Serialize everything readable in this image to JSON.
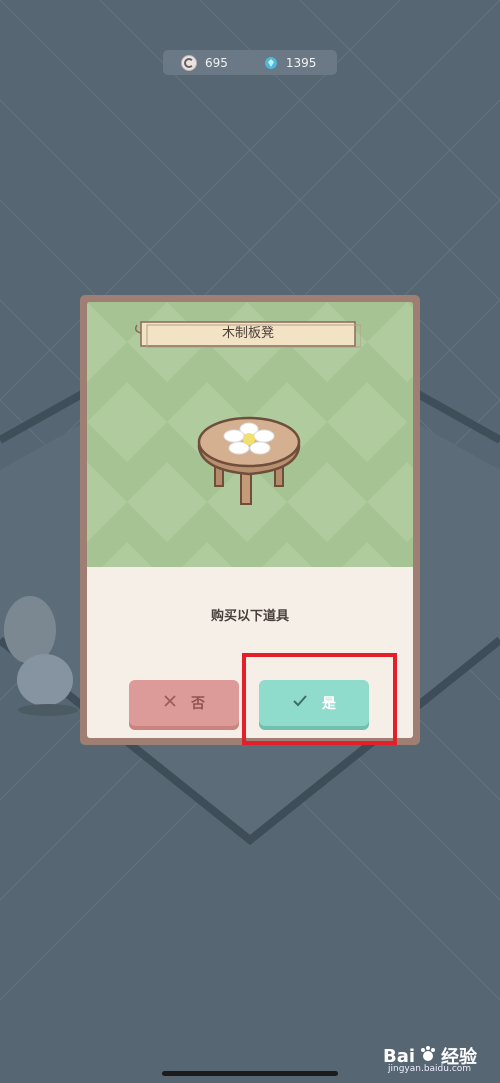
{
  "currency": {
    "coins": "695",
    "gems": "1395"
  },
  "modal": {
    "item_name": "木制板凳",
    "prompt": "购买以下道具",
    "no_label": "否",
    "yes_label": "是"
  },
  "watermark": {
    "text": "Bai",
    "logo_text": "经验",
    "url": "jingyan.baidu.com"
  }
}
